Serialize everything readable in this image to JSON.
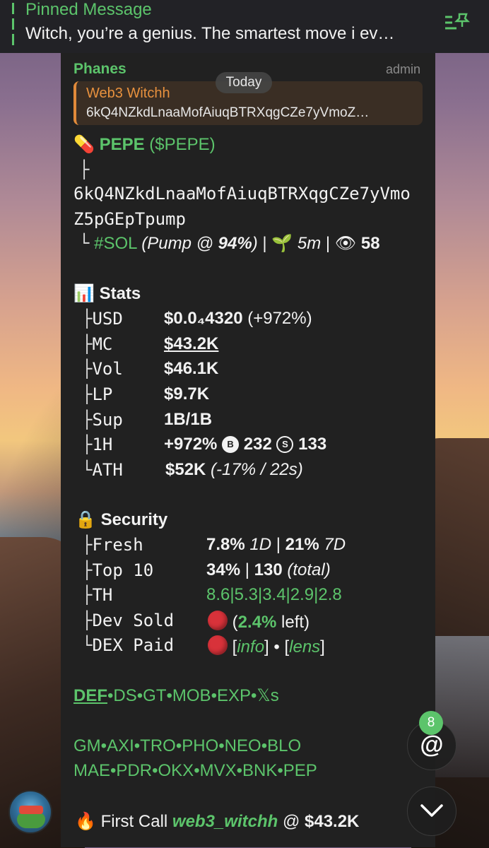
{
  "pinned": {
    "title": "Pinned Message",
    "text": "Witch, you’re a genius. The smartest move i ev…",
    "icon": "pin-list-icon"
  },
  "message": {
    "sender": "Phanes",
    "role": "admin",
    "date_chip": "Today",
    "reply": {
      "name": "Web3 Witchh",
      "text": "6kQ4NZkdLnaaMofAiuqBTRXqgCZe7yVmoZ…"
    },
    "token": {
      "icon": "💊",
      "name": "PEPE",
      "ticker": "($PEPE)",
      "tree_top": "├",
      "address_line1": "6kQ4NZkdLnaaMofAiuqBTRXqgCZe7yVmo",
      "address_line2": "Z5pGEpTpump",
      "tree_end": "└",
      "chain": "#SOL",
      "pump_pre": "(Pump @ ",
      "pump_pct": "94%",
      "pump_post": ")",
      "sep": "|",
      "age_icon": "🌱",
      "age": "5m",
      "views_icon": "👁",
      "views": "58"
    },
    "stats": {
      "icon": "📊",
      "heading": "Stats",
      "rows": [
        {
          "tree": "├",
          "label": "USD",
          "value": "$0.0₄4320",
          "extra": " (+972%)"
        },
        {
          "tree": "├",
          "label": "MC",
          "value": "$43.2K",
          "extra": ""
        },
        {
          "tree": "├",
          "label": "Vol",
          "value": "$46.1K",
          "extra": ""
        },
        {
          "tree": "├",
          "label": "LP",
          "value": "$9.7K",
          "extra": ""
        },
        {
          "tree": "├",
          "label": "Sup",
          "value": "1B/1B",
          "extra": ""
        },
        {
          "tree": "├",
          "label": "1H",
          "value": "+972%",
          "buy_icon": "B",
          "buys": "232",
          "sell_icon": "S",
          "sells": "133"
        },
        {
          "tree": "└",
          "label": "ATH",
          "value": "$52K",
          "extra": "(-17% / 22s)"
        }
      ]
    },
    "security": {
      "icon": "🔒",
      "heading": "Security",
      "fresh": {
        "tree": "├",
        "label": "Fresh",
        "v1": "7.8%",
        "p1": "1D",
        "sep": "|",
        "v2": "21%",
        "p2": "7D"
      },
      "top10": {
        "tree": "├",
        "label": "Top 10",
        "v1": "34%",
        "sep": "|",
        "v2": "130",
        "note": "(total)"
      },
      "th": {
        "tree": "├",
        "label": "TH",
        "value": "8.6|5.3|3.4|2.9|2.8"
      },
      "dev": {
        "tree": "├",
        "label": "Dev Sold",
        "status": "red-circle",
        "open": "(",
        "pct": "2.4%",
        "rest": " left)"
      },
      "dex": {
        "tree": "└",
        "label": "DEX Paid",
        "status": "red-circle",
        "info": "info",
        "dot": "•",
        "lens": "lens"
      }
    },
    "links_row1": [
      "DEF",
      "DS",
      "GT",
      "MOB",
      "EXP",
      "𝕏s"
    ],
    "links_row2": [
      "GM",
      "AXI",
      "TRO",
      "PHO",
      "NEO",
      "BLO"
    ],
    "links_row3": [
      "MAE",
      "PDR",
      "OKX",
      "MVX",
      "BNK",
      "PEP"
    ],
    "link_sep": "•",
    "first_call": {
      "icon": "🔥",
      "label": "First Call",
      "user": "web3_witchh",
      "at": "@",
      "price": "$43.2K"
    }
  },
  "fab": {
    "mention_badge": "8",
    "mention_icon": "@",
    "scroll_icon": "chevron-down-icon"
  },
  "colors": {
    "accent": "#5cc46b",
    "reply_accent": "#e8913e",
    "bubble": "#212121"
  }
}
